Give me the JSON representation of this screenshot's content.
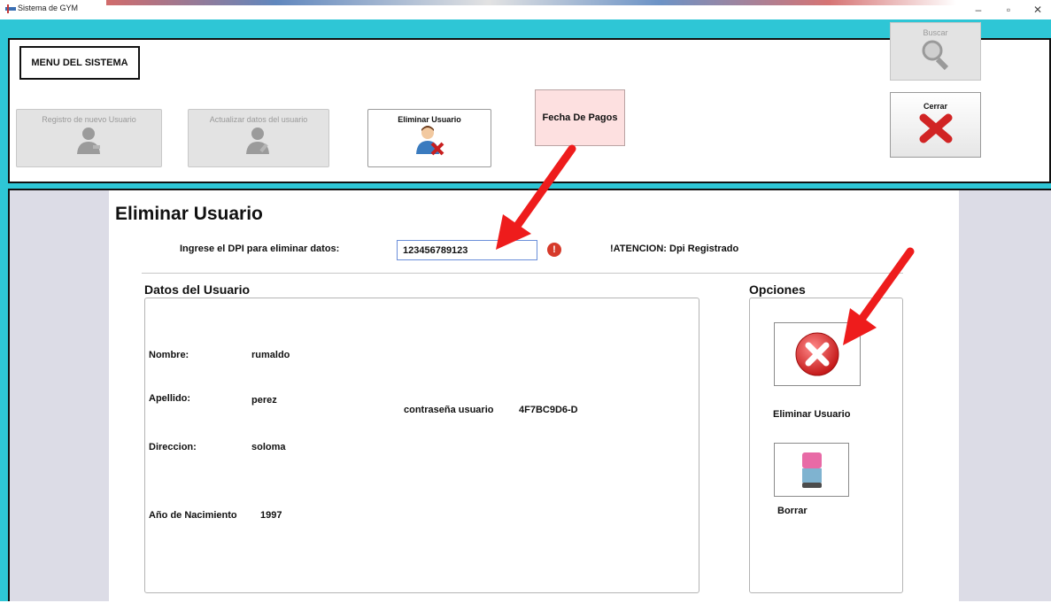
{
  "window": {
    "title": "Sistema de GYM",
    "controls": [
      "–",
      "▫",
      "✕"
    ]
  },
  "topbar": {
    "menu_label": "MENU DEL SISTEMA",
    "buttons": [
      {
        "label": "Registro de nuevo Usuario",
        "icon": "user-add-icon",
        "state": "disabled"
      },
      {
        "label": "Actualizar datos del usuario",
        "icon": "user-edit-icon",
        "state": "disabled"
      },
      {
        "label": "Eliminar Usuario",
        "icon": "user-delete-icon",
        "state": "active"
      }
    ],
    "fecha_label": "Fecha De Pagos",
    "buscar_label": "Buscar",
    "cerrar_label": "Cerrar"
  },
  "main": {
    "title": "Eliminar Usuario",
    "dpi_label": "Ingrese el DPI para eliminar datos:",
    "dpi_value": "123456789123",
    "warning": "!ATENCION: Dpi Registrado",
    "datos_title": "Datos del Usuario",
    "opciones_title": "Opciones",
    "user": {
      "nombre_label": "Nombre:",
      "nombre": "rumaldo",
      "apellido_label": "Apellido:",
      "apellido": "perez",
      "direccion_label": "Direccion:",
      "direccion": "soloma",
      "anio_label": "Año de Nacimiento",
      "anio": "1997",
      "pass_label": "contraseña usuario",
      "pass": "4F7BC9D6-D"
    },
    "options": {
      "delete_label": "Eliminar Usuario",
      "clear_label": "Borrar"
    }
  },
  "colors": {
    "frame": "#2ec6d6",
    "side_panel": "#dcdce6",
    "fecha_bg": "#fde0e0",
    "delete_red": "#e03030",
    "annotation_arrow": "#ee1c1c"
  }
}
